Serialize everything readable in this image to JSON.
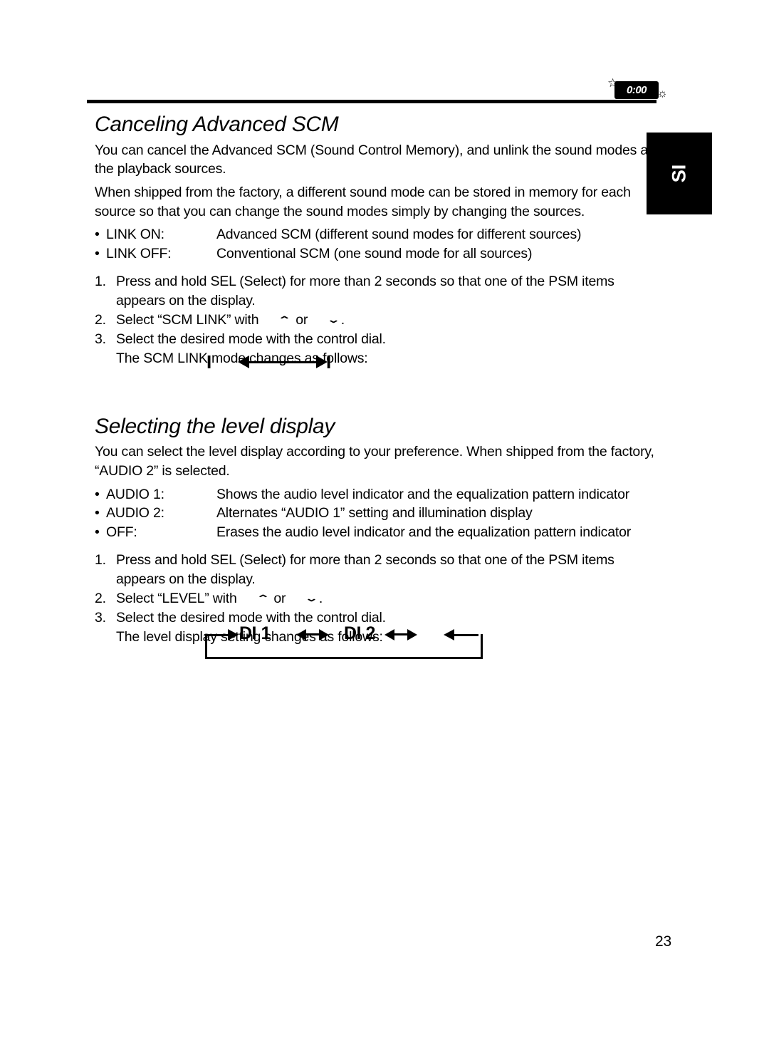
{
  "header": {
    "clock_badge": "0:00",
    "star_icon": "star-outline-icon",
    "sun_icon": "sun-outline-icon"
  },
  "side_tab": {
    "label": "SI"
  },
  "sections": [
    {
      "title": "Canceling Advanced SCM",
      "paragraphs": [
        "You can cancel the Advanced SCM (Sound Control Memory), and unlink the sound modes and the playback sources.",
        "When shipped from the factory, a different sound mode can be stored in memory for each source so that you can change the sound modes simply by changing the sources."
      ],
      "bullets": [
        {
          "label": "LINK ON:",
          "text": "Advanced SCM (different sound modes for different sources)"
        },
        {
          "label": "LINK OFF:",
          "text": "Conventional SCM (one sound mode for all sources)"
        }
      ],
      "steps": [
        {
          "num": "1.",
          "text": "Press and hold SEL (Select) for more than 2 seconds so that one of the PSM items appears on the display."
        },
        {
          "num": "2.",
          "text_before": "Select “SCM LINK” with",
          "chevron_up": "⌃",
          "or_text": "or",
          "chevron_down": "⌄",
          "text_after": "."
        },
        {
          "num": "3.",
          "text": "Select the desired mode with the control dial.",
          "continuation": "The SCM LINK mode changes as follows:"
        }
      ],
      "diagram": {
        "type": "two-state-toggle",
        "left_option": "I",
        "right_option": "I",
        "arrow": "bidirectional"
      }
    },
    {
      "title": "Selecting the level display",
      "paragraphs": [
        "You can select the level display according to your preference. When shipped from the factory, “AUDIO 2” is selected."
      ],
      "bullets": [
        {
          "label": "AUDIO 1:",
          "text": "Shows the audio level indicator and the equalization pattern indicator"
        },
        {
          "label": "AUDIO 2:",
          "text": "Alternates “AUDIO 1” setting and illumination display"
        },
        {
          "label": "OFF:",
          "text": "Erases the audio level indicator and the equalization pattern indicator"
        }
      ],
      "steps": [
        {
          "num": "1.",
          "text": "Press and hold SEL (Select) for more than 2 seconds so that one of the PSM items appears on the display."
        },
        {
          "num": "2.",
          "text_before": "Select “LEVEL” with",
          "chevron_up": "⌃",
          "or_text": "or",
          "chevron_down": "⌄",
          "text_after": "."
        },
        {
          "num": "3.",
          "text": "Select the desired mode with the control dial.",
          "continuation": "The level display setting changes as follows:"
        }
      ],
      "diagram": {
        "type": "cycle",
        "option_1": "DI  1",
        "option_2": "DI  2",
        "option_3": "",
        "loop": "wraps-back-to-start"
      }
    }
  ],
  "footer": {
    "page_number": "23"
  }
}
